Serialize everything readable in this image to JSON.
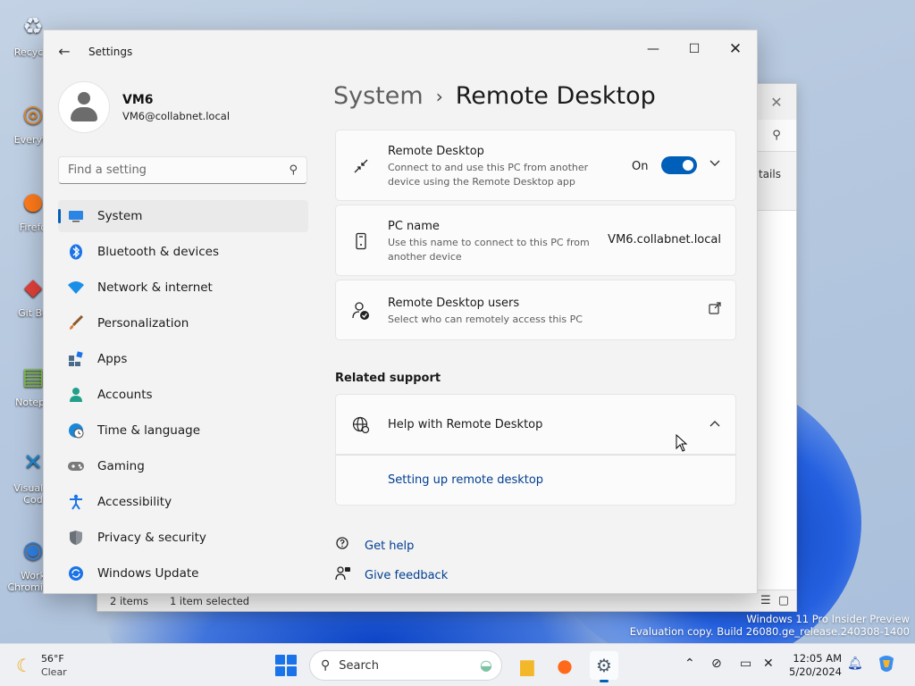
{
  "desktop": {
    "icons": [
      {
        "label": "Recycle",
        "glyph": "recycle-bin-icon"
      },
      {
        "label": "Everyth",
        "glyph": "everything-search-icon"
      },
      {
        "label": "Firefo",
        "glyph": "firefox-icon"
      },
      {
        "label": "Git Ba",
        "glyph": "git-bash-icon"
      },
      {
        "label": "Notepa",
        "glyph": "notepad-plus-plus-icon"
      },
      {
        "label": "Visual S Cod",
        "glyph": "vscode-icon"
      },
      {
        "label": "Work Chromium",
        "glyph": "chromium-icon"
      }
    ]
  },
  "bg_window": {
    "details_label": "tails",
    "status_items": "2 items",
    "status_selected": "1 item selected"
  },
  "settings": {
    "app_title": "Settings",
    "profile": {
      "name": "VM6",
      "email": "VM6@collabnet.local"
    },
    "search": {
      "placeholder": "Find a setting"
    },
    "nav": [
      {
        "label": "System",
        "icon": "system-display-icon",
        "color": "#1d6fd6"
      },
      {
        "label": "Bluetooth & devices",
        "icon": "bluetooth-icon",
        "color": "#1a73e8"
      },
      {
        "label": "Network & internet",
        "icon": "wifi-icon",
        "color": "#1a8fe8"
      },
      {
        "label": "Personalization",
        "icon": "brush-icon",
        "color": "#d97a2b"
      },
      {
        "label": "Apps",
        "icon": "apps-icon",
        "color": "#4a6a8a"
      },
      {
        "label": "Accounts",
        "icon": "accounts-icon",
        "color": "#20a08a"
      },
      {
        "label": "Time & language",
        "icon": "globe-clock-icon",
        "color": "#1a88d8"
      },
      {
        "label": "Gaming",
        "icon": "gamepad-icon",
        "color": "#6a6a6a"
      },
      {
        "label": "Accessibility",
        "icon": "accessibility-icon",
        "color": "#1a73e8"
      },
      {
        "label": "Privacy & security",
        "icon": "shield-icon",
        "color": "#6b7078"
      },
      {
        "label": "Windows Update",
        "icon": "update-icon",
        "color": "#1a73e8"
      }
    ],
    "breadcrumb": {
      "parent": "System",
      "separator": "›",
      "current": "Remote Desktop"
    },
    "cards": {
      "remote_desktop": {
        "title": "Remote Desktop",
        "desc": "Connect to and use this PC from another device using the Remote Desktop app",
        "toggle_label": "On",
        "toggle_on": true
      },
      "pc_name": {
        "title": "PC name",
        "desc": "Use this name to connect to this PC from another device",
        "value": "VM6.collabnet.local"
      },
      "users": {
        "title": "Remote Desktop users",
        "desc": "Select who can remotely access this PC"
      }
    },
    "related": {
      "title": "Related support",
      "help_title": "Help with Remote Desktop",
      "link": "Setting up remote desktop"
    },
    "footer": {
      "get_help": "Get help",
      "feedback": "Give feedback"
    }
  },
  "watermark": {
    "line1": "Windows 11 Pro Insider Preview",
    "line2": "Evaluation copy. Build 26080.ge_release.240308-1400"
  },
  "taskbar": {
    "weather": {
      "temp": "56°F",
      "cond": "Clear"
    },
    "search_label": "Search",
    "clock": {
      "time": "12:05 AM",
      "date": "5/20/2024"
    }
  }
}
